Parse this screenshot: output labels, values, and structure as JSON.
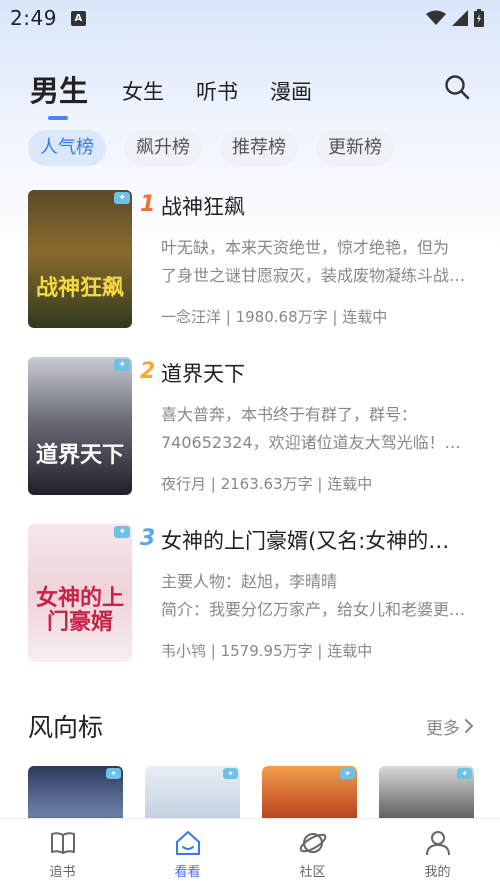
{
  "status_bar": {
    "time": "2:49",
    "app_icon_letter": "A"
  },
  "top_tabs": [
    {
      "label": "男生",
      "active": true
    },
    {
      "label": "女生",
      "active": false
    },
    {
      "label": "听书",
      "active": false
    },
    {
      "label": "漫画",
      "active": false
    }
  ],
  "search_icon": "search-icon",
  "sub_tabs": [
    {
      "label": "人气榜",
      "active": true
    },
    {
      "label": "飙升榜",
      "active": false
    },
    {
      "label": "推荐榜",
      "active": false
    },
    {
      "label": "更新榜",
      "active": false
    }
  ],
  "books": [
    {
      "rank": "1",
      "rank_color": "#f0703a",
      "title": "战神狂飙",
      "desc_lines": [
        "叶无缺，本来天资绝世，惊才绝艳，但为",
        "了身世之谜甘愿寂灭，装成废物凝练斗战…"
      ],
      "meta": "一念汪洋 | 1980.68万字 | 连载中",
      "cover_text": "战神狂飙",
      "cover_bg": "linear-gradient(180deg,#5b4a2a 0%,#8a6a2c 45%,#2f3a1e 100%)",
      "cover_text_color": "#f5d842"
    },
    {
      "rank": "2",
      "rank_color": "#f2a93b",
      "title": "道界天下",
      "desc_lines": [
        "喜大普奔，本书终于有群了，群号：",
        "740652324，欢迎诸位道友大驾光临！（…"
      ],
      "meta": "夜行月 | 2163.63万字 | 连载中",
      "cover_text": "道界天下",
      "cover_bg": "linear-gradient(180deg,#c9ccd3 0%,#6b6e78 45%,#1e2028 100%)",
      "cover_text_color": "#ffffff"
    },
    {
      "rank": "3",
      "rank_color": "#5aa7e6",
      "title": "女神的上门豪婿(又名:女神的…",
      "desc_lines": [
        "主要人物：赵旭，李晴晴",
        "简介：我要分亿万家产，给女儿和老婆更…"
      ],
      "meta": "韦小鸨 | 1579.95万字 | 连载中",
      "cover_text": "女神的上门豪婿",
      "cover_bg": "linear-gradient(180deg,#f6e7ea 0%,#efd2d8 50%,#f8eef0 100%)",
      "cover_text_color": "#c8234a"
    }
  ],
  "section": {
    "title": "风向标",
    "more_label": "更多"
  },
  "thumbs": [
    {
      "bg": "linear-gradient(180deg,#2c3a5a 0%,#6a7fa8 60%,#1e2536 100%)"
    },
    {
      "bg": "linear-gradient(180deg,#e9eef5 0%,#c7d3e3 60%,#9fb1c8 100%)"
    },
    {
      "bg": "linear-gradient(180deg,#f2a04a 0%,#c8562a 50%,#7a2a18 100%)"
    },
    {
      "bg": "linear-gradient(180deg,#d9d9d9 0%,#7a7a7a 50%,#2a2a2a 100%)"
    }
  ],
  "bottom_nav": [
    {
      "label": "追书",
      "icon": "book-icon",
      "active": false
    },
    {
      "label": "看看",
      "icon": "home-icon",
      "active": true
    },
    {
      "label": "社区",
      "icon": "planet-icon",
      "active": false
    },
    {
      "label": "我的",
      "icon": "user-icon",
      "active": false
    }
  ],
  "colors": {
    "accent": "#3a78e8",
    "indicator": "#4a86f0"
  }
}
